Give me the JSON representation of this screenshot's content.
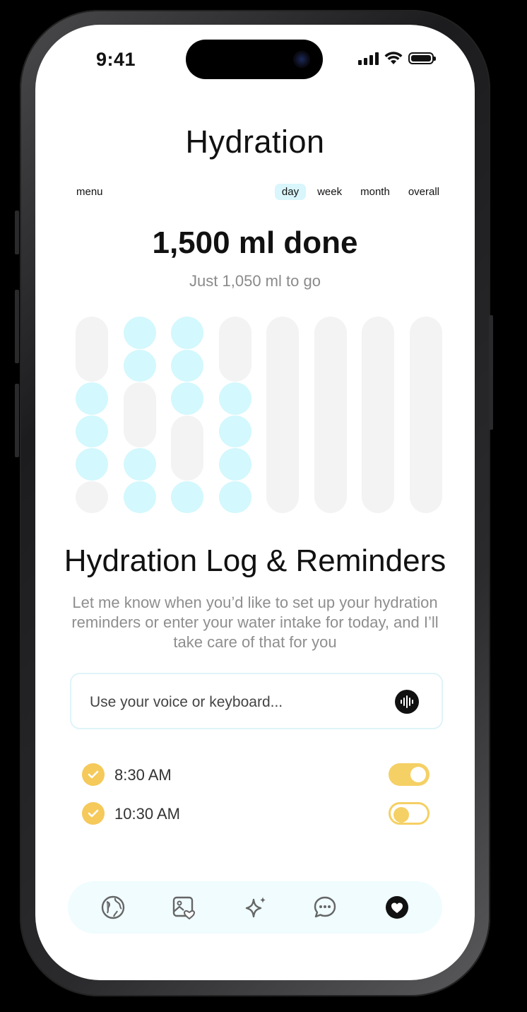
{
  "status_bar": {
    "time": "9:41"
  },
  "header": {
    "title": "Hydration"
  },
  "nav": {
    "menu_label": "menu",
    "periods": [
      "day",
      "week",
      "month",
      "overall"
    ],
    "active_period": "day"
  },
  "summary": {
    "done_text": "1,500 ml done",
    "to_go_text": "Just 1,050 ml to go"
  },
  "intake_bars": [
    {
      "slots": [
        "empty",
        "empty",
        "filled",
        "filled",
        "filled",
        "empty"
      ]
    },
    {
      "slots": [
        "filled",
        "filled",
        "empty",
        "empty",
        "filled",
        "filled"
      ]
    },
    {
      "slots": [
        "filled",
        "filled",
        "filled",
        "empty",
        "empty",
        "filled"
      ]
    },
    {
      "slots": [
        "empty",
        "empty",
        "filled",
        "filled",
        "filled",
        "filled"
      ]
    },
    {
      "slots": [
        "empty",
        "empty",
        "empty",
        "empty",
        "empty",
        "empty"
      ]
    },
    {
      "slots": [
        "empty",
        "empty",
        "empty",
        "empty",
        "empty",
        "empty"
      ]
    },
    {
      "slots": [
        "empty",
        "empty",
        "empty",
        "empty",
        "empty",
        "empty"
      ]
    },
    {
      "slots": [
        "empty",
        "empty",
        "empty",
        "empty",
        "empty",
        "empty"
      ]
    }
  ],
  "log": {
    "title": "Hydration Log & Reminders",
    "description": "Let me know when you’d like to set up your hydration reminders or enter your water intake for today, and I’ll take care of that for you",
    "input_placeholder": "Use your voice or keyboard...",
    "mic_icon": "voice-waveform-icon"
  },
  "reminders": [
    {
      "time": "8:30 AM",
      "checked": true,
      "enabled": true
    },
    {
      "time": "10:30 AM",
      "checked": true,
      "enabled": false
    }
  ],
  "tab_bar": {
    "items": [
      {
        "icon": "globe-icon",
        "active": false
      },
      {
        "icon": "photo-heart-icon",
        "active": false
      },
      {
        "icon": "sparkle-icon",
        "active": false
      },
      {
        "icon": "chat-bubble-icon",
        "active": false
      },
      {
        "icon": "heart-icon",
        "active": true
      }
    ]
  },
  "colors": {
    "water_fill": "#d3f8fd",
    "empty_fill": "#f3f3f3",
    "accent_yellow": "#f5c95a",
    "active_tab_bg": "#d8f6fb",
    "tab_bar_bg": "#f0fcfe"
  }
}
